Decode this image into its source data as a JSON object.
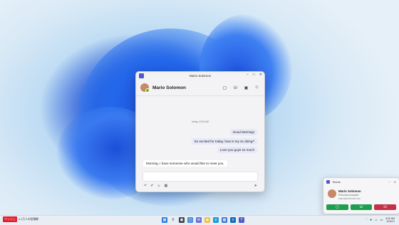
{
  "window": {
    "title": "Mario Solomon",
    "contact_name": "Mario Solomon",
    "timestamp": "today, 8:00 AM",
    "messages_out": [
      "Good Morning!",
      "So excited for today, how is my so doing?",
      "Love you guys so much"
    ],
    "message_in": "Morning, I have someone who would like to meet you."
  },
  "toast": {
    "app_name": "Teams",
    "caller_name": "Mario Solomon",
    "subtitle": "Personal computer",
    "detail": "mario@relecloud.com"
  },
  "taskbar": {
    "notice_tag": "ウィジェ",
    "notice_text": "4.1万人の投稿数",
    "clock_time": "8:00 AM",
    "clock_date": "6/24/21"
  },
  "colors": {
    "teams": "#5059c9",
    "accept": "#1f9e4f",
    "decline": "#c4314b",
    "presence": "#6bb700"
  },
  "icons": [
    "teams-icon",
    "video-call-icon",
    "audio-call-icon",
    "screen-share-icon",
    "people-icon",
    "format-icon",
    "attach-icon",
    "emoji-icon",
    "gif-icon",
    "send-icon",
    "windows-start-icon",
    "search-icon"
  ]
}
